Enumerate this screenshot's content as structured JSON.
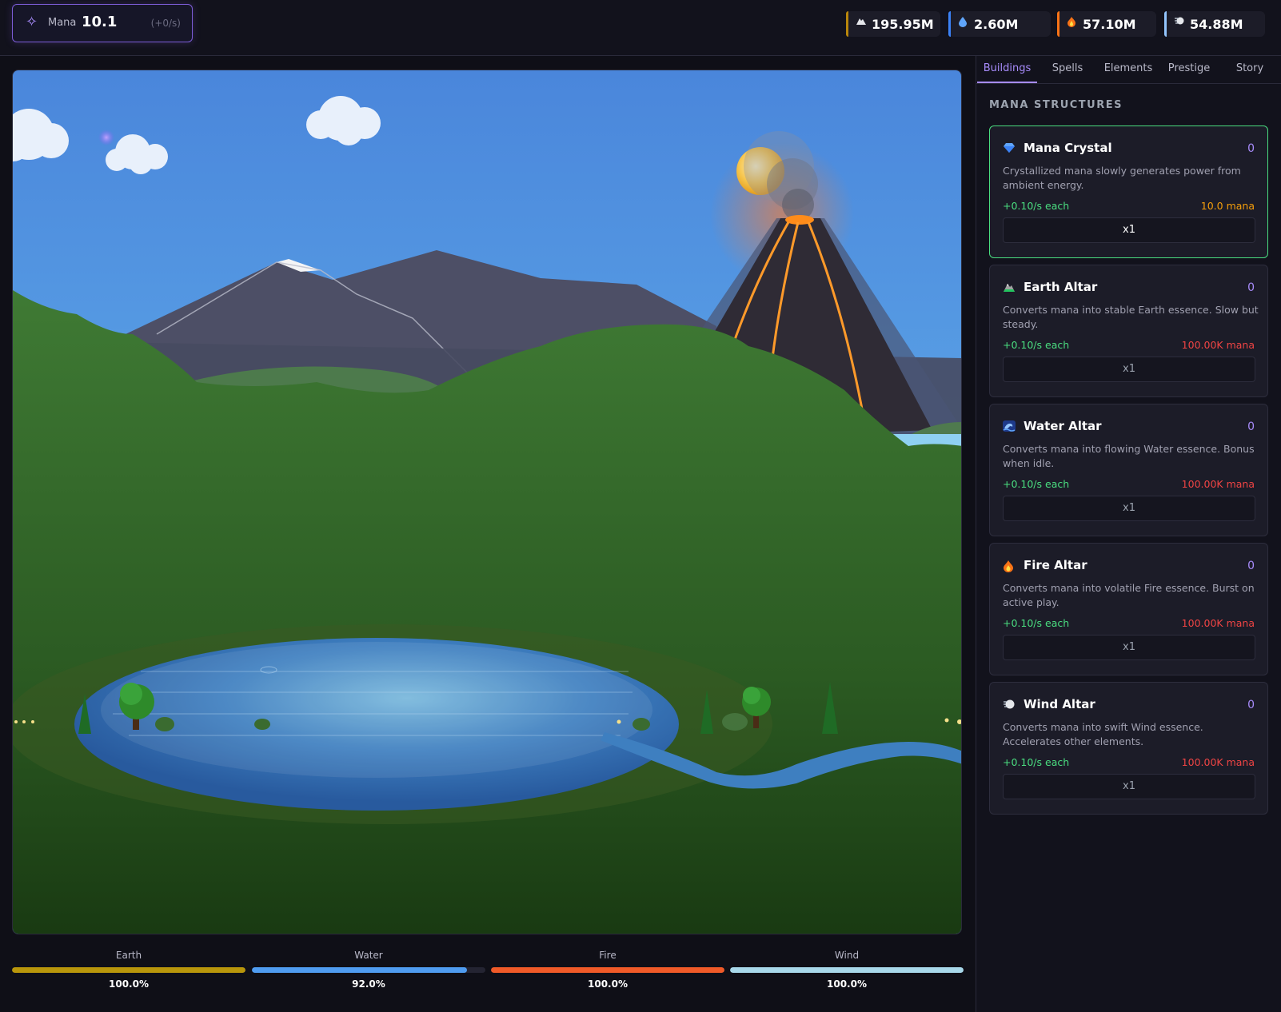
{
  "mana": {
    "icon": "sparkle-icon",
    "label": "Mana",
    "value": "10.1",
    "rate": "(+0/s)"
  },
  "resources": [
    {
      "name": "earth",
      "icon": "mountain-icon",
      "value": "195.95M",
      "color": "#b8860b"
    },
    {
      "name": "water",
      "icon": "droplet-icon",
      "value": "2.60M",
      "color": "#3b82f6"
    },
    {
      "name": "fire",
      "icon": "flame-icon",
      "value": "57.10M",
      "color": "#f97316"
    },
    {
      "name": "wind",
      "icon": "wind-icon",
      "value": "54.88M",
      "color": "#93c5fd"
    }
  ],
  "tabs": [
    "Buildings",
    "Spells",
    "Elements",
    "Prestige",
    "Story"
  ],
  "active_tab": "Buildings",
  "section_title": "MANA STRUCTURES",
  "buildings": [
    {
      "icon": "gem-icon",
      "name": "Mana Crystal",
      "count": "0",
      "desc": "Crystallized mana slowly generates power from ambient energy.",
      "rate": "+0.10/s each",
      "cost": "10.0 mana",
      "affordable": true,
      "button": "x1"
    },
    {
      "icon": "mountain-icon",
      "name": "Earth Altar",
      "count": "0",
      "desc": "Converts mana into stable Earth essence. Slow but steady.",
      "rate": "+0.10/s each",
      "cost": "100.00K mana",
      "affordable": false,
      "button": "x1"
    },
    {
      "icon": "wave-icon",
      "name": "Water Altar",
      "count": "0",
      "desc": "Converts mana into flowing Water essence. Bonus when idle.",
      "rate": "+0.10/s each",
      "cost": "100.00K mana",
      "affordable": false,
      "button": "x1"
    },
    {
      "icon": "flame-icon",
      "name": "Fire Altar",
      "count": "0",
      "desc": "Converts mana into volatile Fire essence. Burst on active play.",
      "rate": "+0.10/s each",
      "cost": "100.00K mana",
      "affordable": false,
      "button": "x1"
    },
    {
      "icon": "wind-icon",
      "name": "Wind Altar",
      "count": "0",
      "desc": "Converts mana into swift Wind essence. Accelerates other elements.",
      "rate": "+0.10/s each",
      "cost": "100.00K mana",
      "affordable": false,
      "button": "x1"
    }
  ],
  "meters": [
    {
      "label": "Earth",
      "percent": "100.0%",
      "fill": 1.0,
      "color": "#b8960b"
    },
    {
      "label": "Water",
      "percent": "92.0%",
      "fill": 0.92,
      "color": "#4f9cf0"
    },
    {
      "label": "Fire",
      "percent": "100.0%",
      "fill": 1.0,
      "color": "#f05a28"
    },
    {
      "label": "Wind",
      "percent": "100.0%",
      "fill": 1.0,
      "color": "#a8d8ea"
    }
  ],
  "scene_button": {
    "icon": "hexagon-icon"
  }
}
